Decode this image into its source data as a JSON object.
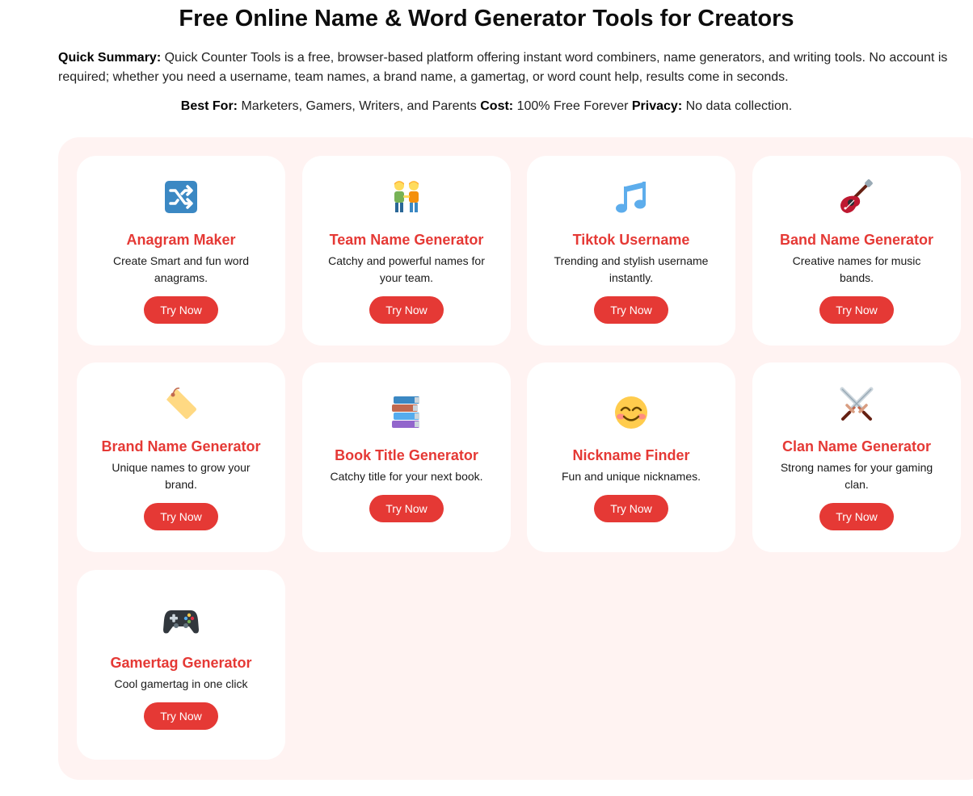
{
  "page": {
    "title": "Free Online Name & Word Generator Tools for Creators",
    "summary_label": "Quick Summary:",
    "summary_text": " Quick Counter Tools is a free, browser-based platform offering instant word combiners, name generators, and writing tools. No account is required; whether you need a username, team names, a brand name, a gamertag, or word count help, results come in seconds.",
    "best_for_label": "Best For:",
    "best_for_text": " Marketers, Gamers, Writers, and Parents ",
    "cost_label": "Cost:",
    "cost_text": " 100% Free Forever ",
    "privacy_label": "Privacy:",
    "privacy_text": " No data collection."
  },
  "colors": {
    "accent": "#e53935",
    "panel_bg": "#fff3f2",
    "card_bg": "#ffffff"
  },
  "tools": [
    {
      "title": "Anagram Maker",
      "desc": "Create Smart and fun word anagrams.",
      "button": "Try Now",
      "icon": "shuffle-icon"
    },
    {
      "title": "Team Name Generator",
      "desc": "Catchy and powerful names for your team.",
      "button": "Try Now",
      "icon": "team-people-icon"
    },
    {
      "title": "Tiktok Username",
      "desc": "Trending and stylish username instantly.",
      "button": "Try Now",
      "icon": "music-notes-icon"
    },
    {
      "title": "Band Name Generator",
      "desc": "Creative names for music bands.",
      "button": "Try Now",
      "icon": "guitar-icon"
    },
    {
      "title": "Brand Name Generator",
      "desc": "Unique names to grow your brand.",
      "button": "Try Now",
      "icon": "label-tag-icon"
    },
    {
      "title": "Book Title Generator",
      "desc": "Catchy title for your next book.",
      "button": "Try Now",
      "icon": "books-icon"
    },
    {
      "title": "Nickname Finder",
      "desc": "Fun and unique nicknames.",
      "button": "Try Now",
      "icon": "smiling-face-icon"
    },
    {
      "title": "Clan Name Generator",
      "desc": "Strong names for your gaming clan.",
      "button": "Try Now",
      "icon": "crossed-swords-icon"
    },
    {
      "title": "Gamertag Generator",
      "desc": "Cool gamertag in one click",
      "button": "Try Now",
      "icon": "game-controller-icon"
    }
  ]
}
